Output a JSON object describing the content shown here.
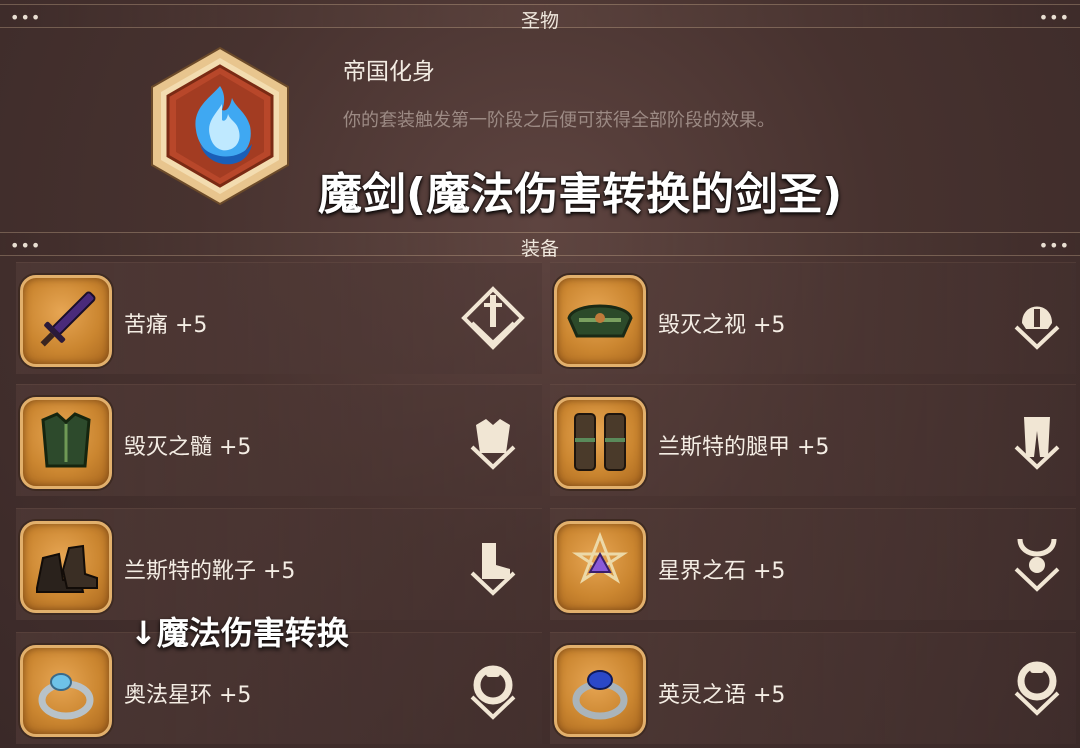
{
  "relic_section": {
    "title": "圣物"
  },
  "relic": {
    "name": "帝国化身",
    "description": "你的套装触发第一阶段之后便可获得全部阶段的效果。"
  },
  "annotation": {
    "title": "魔剑(魔法伤害转换的剑圣)",
    "arrow_note": "↓魔法伤害转换"
  },
  "equip_section": {
    "title": "装备"
  },
  "dots": "•••",
  "equipment": [
    {
      "label": "苦痛 +5",
      "item_icon": "purple-sword-icon",
      "slot_icon": "weapon-slot-icon"
    },
    {
      "label": "毁灭之视 +5",
      "item_icon": "green-helmet-icon",
      "slot_icon": "helmet-slot-icon"
    },
    {
      "label": "毁灭之髓 +5",
      "item_icon": "green-armor-icon",
      "slot_icon": "chest-slot-icon"
    },
    {
      "label": "兰斯特的腿甲 +5",
      "item_icon": "greaves-icon",
      "slot_icon": "legs-slot-icon"
    },
    {
      "label": "兰斯特的靴子 +5",
      "item_icon": "boots-icon",
      "slot_icon": "boots-slot-icon"
    },
    {
      "label": "星界之石 +5",
      "item_icon": "star-stone-icon",
      "slot_icon": "amulet-slot-icon"
    },
    {
      "label": "奥法星环 +5",
      "item_icon": "silver-ring-icon",
      "slot_icon": "ring-slot-icon"
    },
    {
      "label": "英灵之语 +5",
      "item_icon": "blue-ring-icon",
      "slot_icon": "ring-slot-icon"
    }
  ],
  "colors": {
    "background": "#47322f",
    "item_frame": "#cb8630",
    "slot_icon": "#f1e6d4",
    "relic_frame": "#b64a24"
  }
}
